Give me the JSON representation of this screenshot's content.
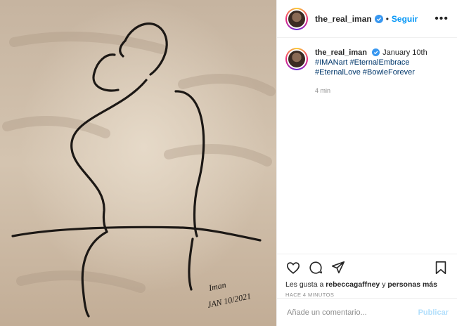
{
  "post": {
    "username": "the_real_iman",
    "follow_label": "Seguir",
    "more_label": "•••",
    "caption_text": "January 10th",
    "hashtags": [
      "#IMANart",
      "#EternalEmbrace",
      "#EternalLove",
      "#BowieForever"
    ],
    "caption_time": "4 min",
    "likes_prefix": "Les gusta a",
    "likes_user": "rebeccagaffney",
    "likes_and": "y",
    "likes_others": "personas más",
    "time_ago": "HACE 4 MINUTOS",
    "comment_placeholder": "Añade un comentario...",
    "publish_label": "Publicar",
    "artwork_signature": "Iman JAN 10/2021"
  },
  "colors": {
    "accent": "#0095f6",
    "publish_disabled": "#b2dffc",
    "hashtag": "#00376b",
    "muted": "#8e8e8e"
  }
}
